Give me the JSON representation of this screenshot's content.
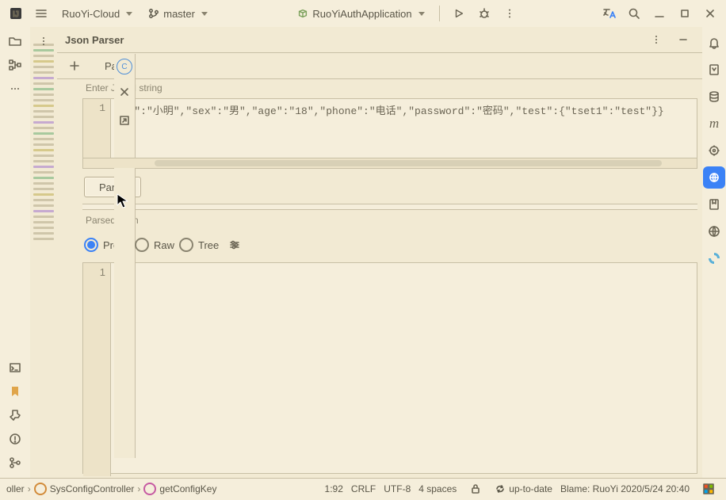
{
  "topbar": {
    "project": "RuoYi-Cloud",
    "branch": "master",
    "run_config": "RuoYiAuthApplication"
  },
  "tool_window": {
    "title": "Json Parser",
    "tab": "Parser",
    "input_label": "Enter JSON string",
    "input_line": "1",
    "input_code": "ame\":\"小明\",\"sex\":\"男\",\"age\":\"18\",\"phone\":\"电话\",\"password\":\"密码\",\"test\":{\"tset1\":\"test\"}}",
    "parse_btn": "Parse",
    "output_label": "Parsed Json",
    "views": {
      "pretty": "Pretty",
      "raw": "Raw",
      "tree": "Tree"
    },
    "selected_view": "pretty",
    "output_line": "1"
  },
  "breadcrumb": {
    "a": "oller",
    "b": "SysConfigController",
    "c": "getConfigKey"
  },
  "status": {
    "pos": "1:92",
    "eol": "CRLF",
    "enc": "UTF-8",
    "indent": "4 spaces",
    "vcs": "up-to-date",
    "blame": "Blame: RuoYi 2020/5/24 20:40"
  }
}
